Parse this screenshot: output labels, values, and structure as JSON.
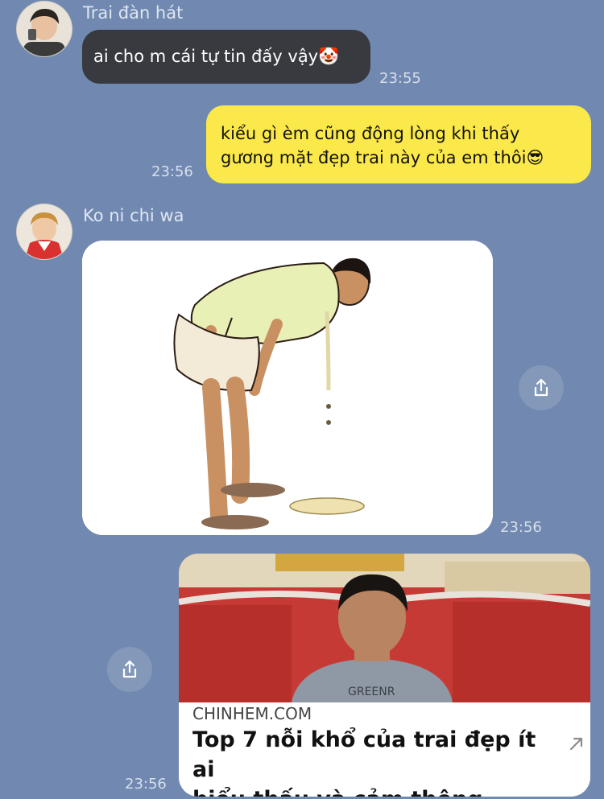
{
  "messages": {
    "m1": {
      "sender": "Trai đàn hát",
      "text": "ai cho m cái tự tin đấy vậy🤡",
      "time": "23:55"
    },
    "m2": {
      "line1": "kiểu gì èm cũng động lòng khi thấy",
      "line2": "gương mặt đẹp trai này của em thôi😎",
      "time": "23:56"
    },
    "m3": {
      "sender": "Ko ni chi wa",
      "time": "23:56"
    },
    "m4": {
      "domain": "CHINHEM.COM",
      "title_line1": "Top 7 nỗi khổ của trai đẹp ít ai",
      "title_line2": "hiểu thấu và cảm thông",
      "shirt_text": "GREENR",
      "time": "23:56"
    }
  },
  "icons": {
    "share": "share-icon",
    "external": "external-link-arrow-icon"
  },
  "colors": {
    "background": "#7189b0",
    "incoming_bubble": "#383a3f",
    "outgoing_bubble": "#fbe84a"
  }
}
